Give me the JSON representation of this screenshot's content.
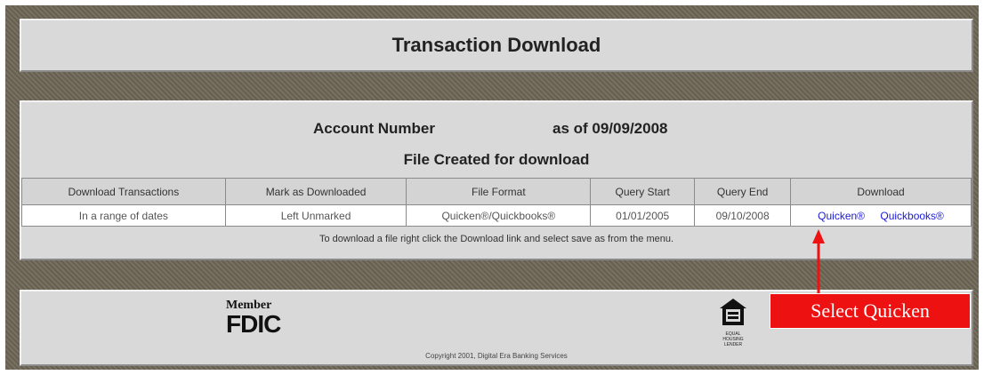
{
  "title": "Transaction Download",
  "account": {
    "label": "Account Number",
    "as_of": "as of 09/09/2008",
    "status": "File Created for download"
  },
  "table": {
    "headers": [
      "Download Transactions",
      "Mark as Downloaded",
      "File Format",
      "Query Start",
      "Query End",
      "Download"
    ],
    "row": {
      "range": "In a range of dates",
      "mark": "Left Unmarked",
      "format": "Quicken®/Quickbooks®",
      "start": "01/01/2005",
      "end": "09/10/2008",
      "link_quicken": "Quicken®",
      "link_quickbooks": "Quickbooks®"
    }
  },
  "note": "To download a file right click the Download link and select save as from the menu.",
  "footer": {
    "member": "Member",
    "fdic": "FDIC",
    "copyright": "Copyright 2001, Digital Era Banking Services",
    "eho_text": "EQUAL HOUSING LENDER"
  },
  "callout": {
    "text": "Select Quicken",
    "color": "#ee1111"
  },
  "colors": {
    "frame": "#6d6656",
    "panel": "#d9d9d9",
    "link": "#1a1ad8"
  }
}
